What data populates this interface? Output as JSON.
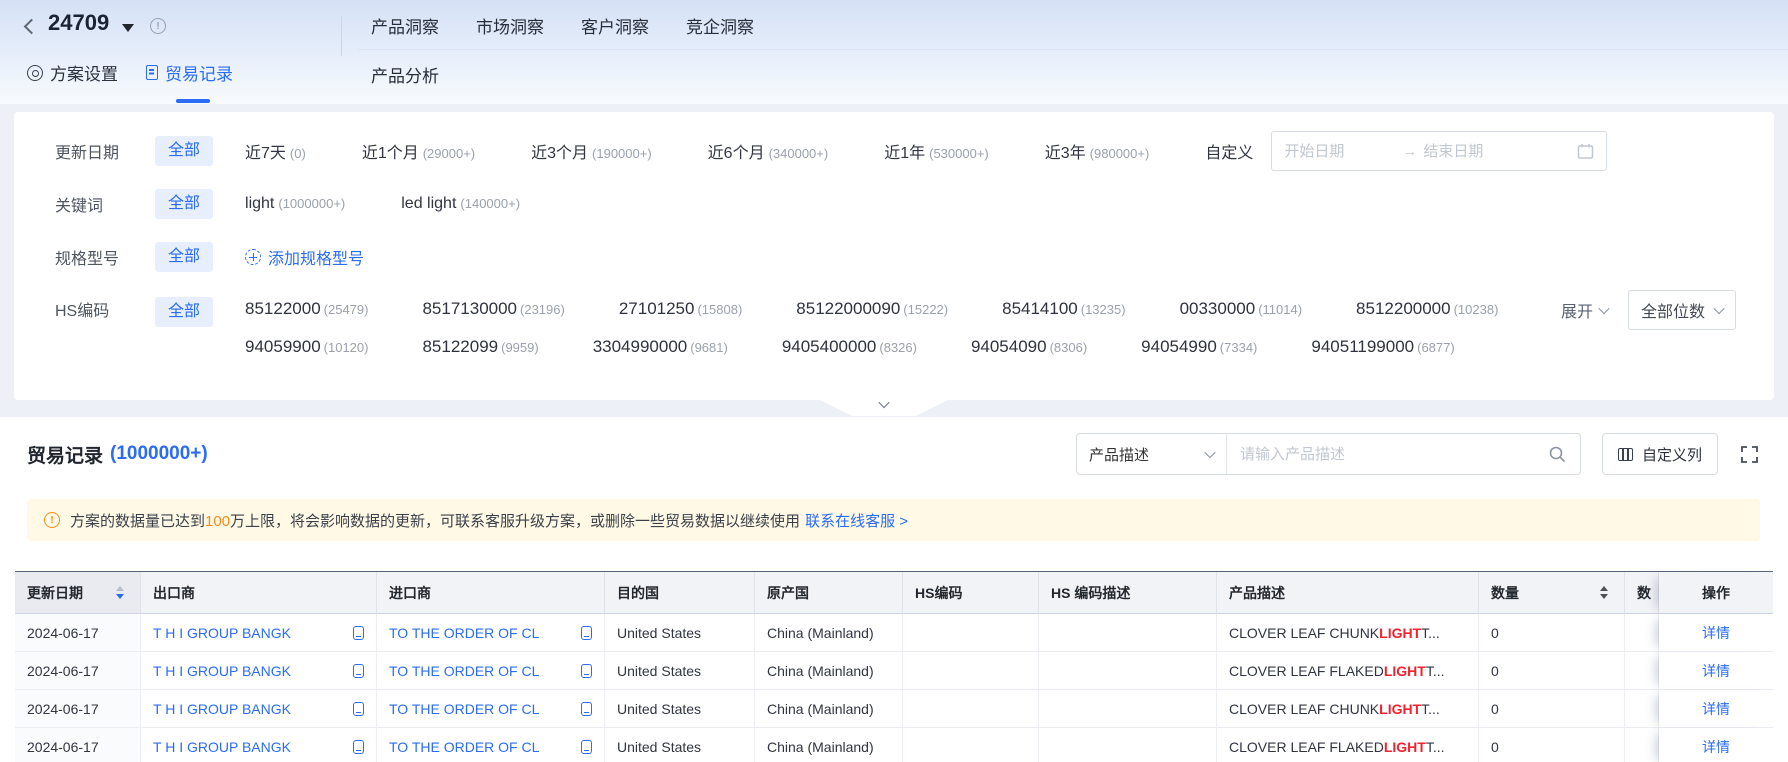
{
  "colors": {
    "accent": "#2a6cf5",
    "keyword_highlight": "#f5222d",
    "warning": "#fa8c16",
    "selected_chip_bg": "#e7efff"
  },
  "icons": {
    "back": "chevron-left",
    "plan_caret": "triangle-down",
    "info": "exclamation-circle",
    "settings": "target-circle",
    "records": "document",
    "add": "dashed-plus-circle",
    "calendar": "calendar",
    "range_arrow": "arrow-right",
    "search": "magnifier",
    "customize": "table-columns",
    "fullscreen": "expand-corners",
    "warning": "exclamation-circle",
    "copy": "copy",
    "collapse": "chevron-down"
  },
  "header": {
    "plan_id": "24709",
    "nav": [
      {
        "label": "产品洞察"
      },
      {
        "label": "市场洞察"
      },
      {
        "label": "客户洞察"
      },
      {
        "label": "竞企洞察"
      }
    ],
    "subnav": {
      "label": "产品分析"
    },
    "tabs": {
      "settings": "方案设置",
      "records": "贸易记录"
    }
  },
  "filters": {
    "update_date": {
      "label": "更新日期",
      "all": "全部",
      "options": [
        {
          "name": "近7天",
          "count": "(0)"
        },
        {
          "name": "近1个月",
          "count": "(29000+)"
        },
        {
          "name": "近3个月",
          "count": "(190000+)"
        },
        {
          "name": "近6个月",
          "count": "(340000+)"
        },
        {
          "name": "近1年",
          "count": "(530000+)"
        },
        {
          "name": "近3年",
          "count": "(980000+)"
        }
      ],
      "custom": "自定义",
      "start_placeholder": "开始日期",
      "end_placeholder": "结束日期"
    },
    "keyword": {
      "label": "关键词",
      "all": "全部",
      "options": [
        {
          "name": "light",
          "count": "(1000000+)"
        },
        {
          "name": "led light",
          "count": "(140000+)"
        }
      ]
    },
    "spec": {
      "label": "规格型号",
      "all": "全部",
      "add": "添加规格型号"
    },
    "hs_code": {
      "label": "HS编码",
      "all": "全部",
      "row1": [
        {
          "code": "85122000",
          "count": "(25479)"
        },
        {
          "code": "8517130000",
          "count": "(23196)"
        },
        {
          "code": "27101250",
          "count": "(15808)"
        },
        {
          "code": "85122000090",
          "count": "(15222)"
        },
        {
          "code": "85414100",
          "count": "(13235)"
        },
        {
          "code": "00330000",
          "count": "(11014)"
        },
        {
          "code": "8512200000",
          "count": "(10238)"
        }
      ],
      "row2": [
        {
          "code": "94059900",
          "count": "(10120)"
        },
        {
          "code": "85122099",
          "count": "(9959)"
        },
        {
          "code": "3304990000",
          "count": "(9681)"
        },
        {
          "code": "9405400000",
          "count": "(8326)"
        },
        {
          "code": "94054090",
          "count": "(8306)"
        },
        {
          "code": "94054990",
          "count": "(7334)"
        },
        {
          "code": "94051199000",
          "count": "(6877)"
        }
      ],
      "expand": "展开",
      "digits": "全部位数"
    }
  },
  "records": {
    "title": "贸易记录",
    "count": "(1000000+)",
    "search_field": "产品描述",
    "search_placeholder": "请输入产品描述",
    "customize_columns": "自定义列",
    "notice": {
      "prefix": "方案的数据量已达到",
      "highlight": "100",
      "suffix": "万上限，将会影响数据的更新，可联系客服升级方案，或删除一些贸易数据以继续使用",
      "link": "联系在线客服 >"
    },
    "table": {
      "columns": [
        "更新日期",
        "出口商",
        "进口商",
        "目的国",
        "原产国",
        "HS编码",
        "HS 编码描述",
        "产品描述",
        "数量",
        "数",
        "操作"
      ],
      "action_label": "详情",
      "rows": [
        {
          "date": "2024-06-17",
          "exporter": "T H I GROUP BANGK",
          "importer": "TO THE ORDER OF CL",
          "dest": "United States",
          "origin": "China (Mainland)",
          "hs": "",
          "hs_desc": "",
          "product_prefix": "CLOVER LEAF CHUNK ",
          "product_highlight": "LIGHT",
          "product_suffix": " T...",
          "qty": "0"
        },
        {
          "date": "2024-06-17",
          "exporter": "T H I GROUP BANGK",
          "importer": "TO THE ORDER OF CL",
          "dest": "United States",
          "origin": "China (Mainland)",
          "hs": "",
          "hs_desc": "",
          "product_prefix": "CLOVER LEAF FLAKED ",
          "product_highlight": "LIGHT",
          "product_suffix": " T...",
          "qty": "0"
        },
        {
          "date": "2024-06-17",
          "exporter": "T H I GROUP BANGK",
          "importer": "TO THE ORDER OF CL",
          "dest": "United States",
          "origin": "China (Mainland)",
          "hs": "",
          "hs_desc": "",
          "product_prefix": "CLOVER LEAF CHUNK ",
          "product_highlight": "LIGHT",
          "product_suffix": " T...",
          "qty": "0"
        },
        {
          "date": "2024-06-17",
          "exporter": "T H I GROUP BANGK",
          "importer": "TO THE ORDER OF CL",
          "dest": "United States",
          "origin": "China (Mainland)",
          "hs": "",
          "hs_desc": "",
          "product_prefix": "CLOVER LEAF FLAKED ",
          "product_highlight": "LIGHT",
          "product_suffix": " T...",
          "qty": "0"
        }
      ]
    }
  }
}
